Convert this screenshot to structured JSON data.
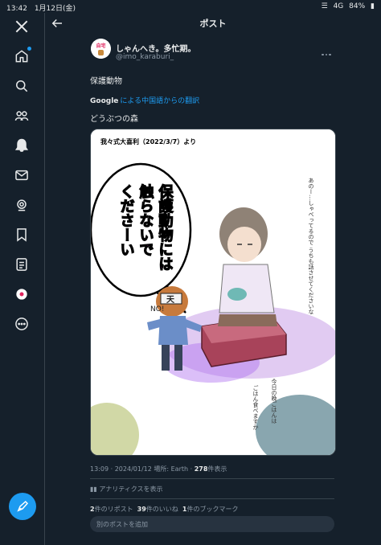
{
  "status_bar": {
    "time": "13:42",
    "date": "1月12日(金)",
    "network": "4G",
    "battery": "84%"
  },
  "colors": {
    "background": "#15202b",
    "accent": "#1d9bf0",
    "muted_text": "#8b98a5",
    "speech_text_magenta": "#e600e6"
  },
  "sidebar": {
    "items": [
      {
        "name": "x-logo-icon"
      },
      {
        "name": "home-icon"
      },
      {
        "name": "search-icon"
      },
      {
        "name": "communities-icon"
      },
      {
        "name": "notifications-icon"
      },
      {
        "name": "messages-icon"
      },
      {
        "name": "grok-icon"
      },
      {
        "name": "bookmarks-icon"
      },
      {
        "name": "lists-icon"
      },
      {
        "name": "profile-avatar"
      },
      {
        "name": "more-icon"
      }
    ],
    "fab": "compose-post-icon"
  },
  "header": {
    "title": "ポスト"
  },
  "post": {
    "avatar_text": "自宅",
    "display_name": "しゃんへき。多忙期。",
    "handle": "@imo_karaburi_",
    "text": "保護動物",
    "translate_brand": "Google",
    "translate_link": "による中国語からの翻訳",
    "translated_text": "どうぶつの森",
    "image": {
      "caption": "我々式大喜利（2022/3/7）より",
      "speech": [
        "保護動物には",
        "触らないで",
        "くださーい"
      ],
      "head_sign": "天",
      "noise": "NO!",
      "side_note": "あのー…しゃべってるので うちも話させてくださいな",
      "bottom_note_1": "ごはん食べますか",
      "bottom_note_2": "今日の晩ごはんは"
    },
    "time": "13:09",
    "date": "2024/01/12",
    "location_label": "場所:",
    "location": "Earth",
    "views": "278",
    "views_label": "件表示",
    "analytics_label": "アナリティクスを表示",
    "reposts": "2",
    "reposts_label": "件のリポスト",
    "likes": "39",
    "likes_label": "件のいいね",
    "bookmarks": "1",
    "bookmarks_label": "件のブックマーク",
    "reply_placeholder": "別のポストを追加"
  }
}
